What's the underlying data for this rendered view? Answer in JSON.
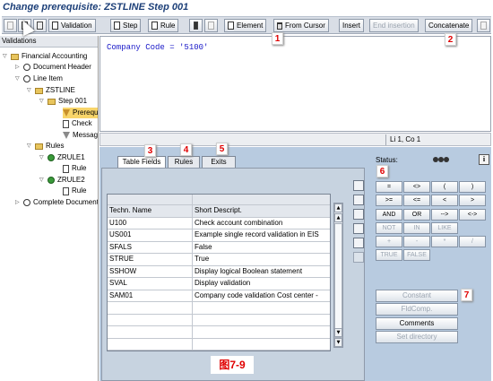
{
  "title": "Change prerequisite: ZSTLINE Step 001",
  "toolbar": {
    "validation": "Validation",
    "step": "Step",
    "rule": "Rule",
    "element": "Element",
    "from_cursor": "From Cursor",
    "insert": "Insert",
    "end_insertion": "End insertion",
    "concatenate": "Concatenate"
  },
  "tree": {
    "header": "Validations",
    "nodes": [
      "Financial Accounting",
      "Document Header",
      "Line Item",
      "ZSTLINE",
      "Step 001",
      "Prerequisite",
      "Check",
      "Message",
      "Rules",
      "ZRULE1",
      "Rule",
      "ZRULE2",
      "Rule",
      "Complete Document"
    ]
  },
  "editor": {
    "code": "Company Code = '5100'",
    "position": "Li 1, Co 1"
  },
  "tabs": [
    "Table Fields",
    "Rules",
    "Exits"
  ],
  "table": {
    "headers": [
      "Techn. Name",
      "Short Descript."
    ],
    "rows": [
      [
        "U100",
        "Check account combination"
      ],
      [
        "US001",
        "Example single record validation in EIS"
      ],
      [
        "SFALS",
        "False"
      ],
      [
        "STRUE",
        "True"
      ],
      [
        "SSHOW",
        "Display logical Boolean statement"
      ],
      [
        "SVAL",
        "Display validation"
      ],
      [
        "SAM01",
        "Company code validation  Cost center -"
      ]
    ]
  },
  "status_label": "Status:",
  "operators": [
    "=",
    "<>",
    "(",
    ")",
    ">=",
    "<=",
    "<",
    ">",
    "AND",
    "OR",
    "-->",
    "<->",
    "NOT",
    "IN",
    "LIKE",
    "+",
    "-",
    "*",
    "/",
    "TRUE",
    "FALSE"
  ],
  "buttons": [
    "Constant",
    "FldComp.",
    "Comments",
    "Set directory"
  ],
  "callouts": [
    "1",
    "2",
    "3",
    "4",
    "5",
    "6",
    "7"
  ],
  "figure_label": "图7-9"
}
